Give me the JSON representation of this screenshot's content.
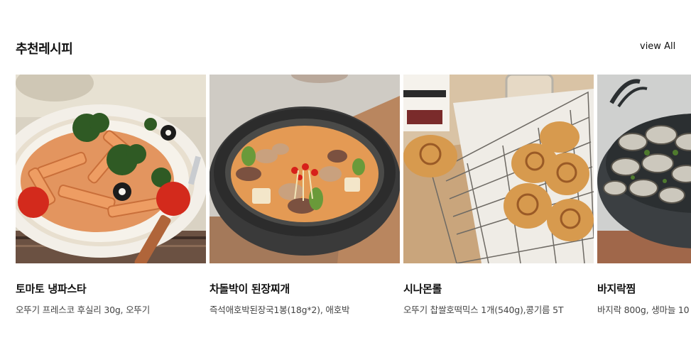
{
  "section": {
    "title": "추천레시피",
    "view_all_label": "view All"
  },
  "cards": [
    {
      "title": "토마토 냉파스타",
      "desc": "오뚜기 프레스코 후실리 30g, 오뚜기"
    },
    {
      "title": "차돌박이 된장찌개",
      "desc": "즉석애호박된장국1봉(18g*2), 애호박"
    },
    {
      "title": "시나몬롤",
      "desc": "오뚜기 찹쌀호떡믹스 1개(540g),콩기름 5T"
    },
    {
      "title": "바지락찜",
      "desc": "바지락 800g, 생마늘 10"
    }
  ]
}
